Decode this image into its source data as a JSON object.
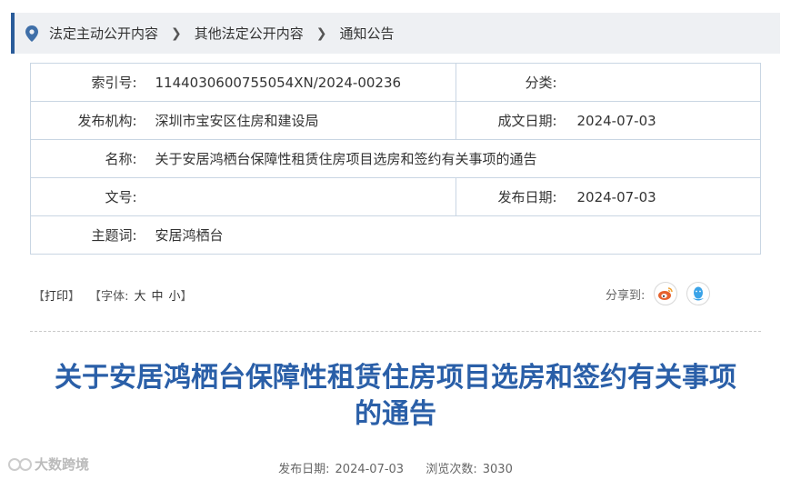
{
  "breadcrumb": {
    "items": [
      "法定主动公开内容",
      "其他法定公开内容",
      "通知公告"
    ],
    "separator": ">"
  },
  "info": {
    "index_label": "索引号:",
    "index_value": "11440306007550 54XN/2024-00236",
    "category_label": "分类:",
    "category_value": "",
    "publisher_label": "发布机构:",
    "publisher_value": "深圳市宝安区住房和建设局",
    "created_label": "成文日期:",
    "created_value": "2024-07-03",
    "name_label": "名称:",
    "name_value": "关于安居鸿栖台保障性租赁住房项目选房和签约有关事项的通告",
    "docno_label": "文号:",
    "docno_value": "",
    "pubdate_label": "发布日期:",
    "pubdate_value": "2024-07-03",
    "keywords_label": "主题词:",
    "keywords_value": "安居鸿栖台"
  },
  "tools": {
    "print": "打印",
    "font_label": "字体:",
    "font_large": "大",
    "font_medium": "中",
    "font_small": "小",
    "share_label": "分享到:"
  },
  "article": {
    "title_line1": "关于安居鸿栖台保障性租赁住房项目选房和签约有关事项",
    "title_line2": "的通告",
    "date_label": "发布日期:",
    "date_value": "2024-07-03",
    "views_label": "浏览次数:",
    "views_value": "3030"
  },
  "watermark": {
    "text": "大数跨境"
  },
  "colors": {
    "accent": "#2a5c9a",
    "title": "#2a5fa8",
    "weibo": "#e6622d",
    "qq": "#3aa3e8"
  }
}
